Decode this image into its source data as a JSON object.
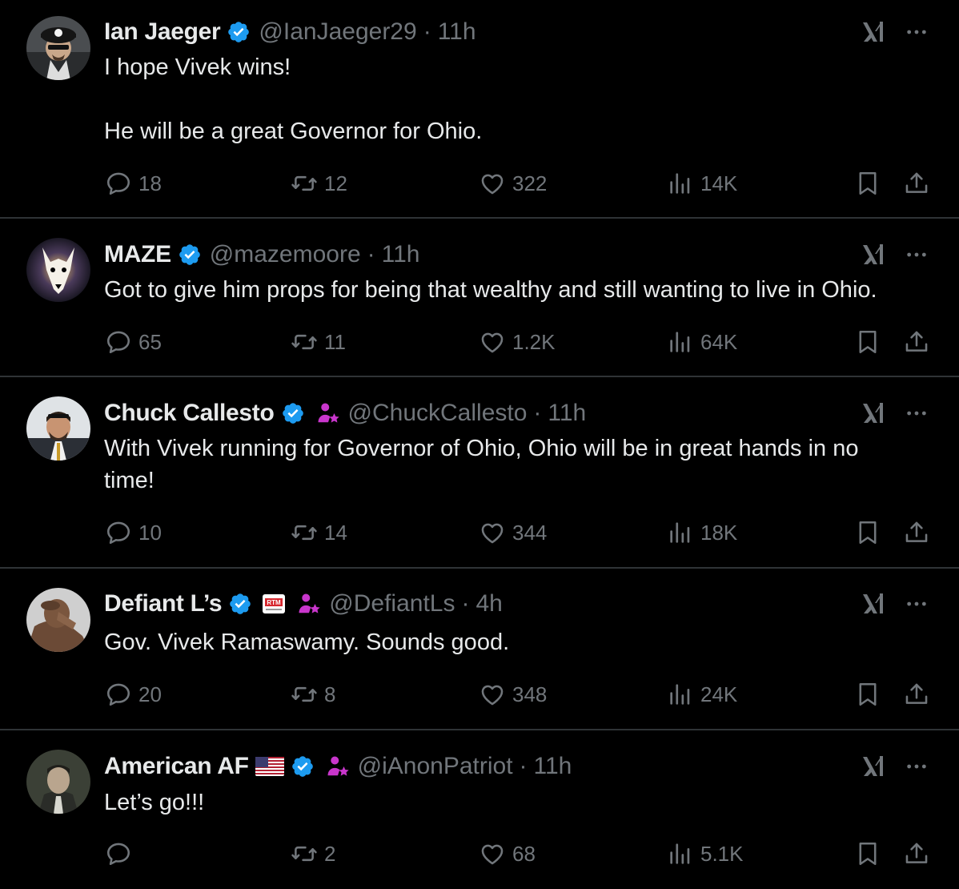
{
  "colors": {
    "background": "#000000",
    "text": "#e7e9ea",
    "muted": "#71767b",
    "verified": "#1d9bf0",
    "affiliate": "#c936cc",
    "divider": "#2f3336"
  },
  "tweets": [
    {
      "name": "Ian Jaeger",
      "handle": "@IanJaeger29",
      "separator": "·",
      "time": "11h",
      "text": "I hope Vivek wins!\n\nHe will be a great Governor for Ohio.",
      "replies": "18",
      "reposts": "12",
      "likes": "322",
      "views": "14K",
      "badges": [
        "verified-badge-icon"
      ]
    },
    {
      "name": "MAZE",
      "handle": "@mazemoore",
      "separator": "·",
      "time": "11h",
      "text": "Got to give him props for being that wealthy and still wanting to live in Ohio.",
      "replies": "65",
      "reposts": "11",
      "likes": "1.2K",
      "views": "64K",
      "badges": [
        "verified-badge-icon"
      ]
    },
    {
      "name": "Chuck Callesto",
      "handle": "@ChuckCallesto",
      "separator": "·",
      "time": "11h",
      "text": "With Vivek running for Governor of Ohio, Ohio will be in great hands in no time!",
      "replies": "10",
      "reposts": "14",
      "likes": "344",
      "views": "18K",
      "badges": [
        "verified-badge-icon",
        "affiliate-person-icon"
      ]
    },
    {
      "name": "Defiant L’s",
      "handle": "@DefiantLs",
      "separator": "·",
      "time": "4h",
      "text": "Gov. Vivek Ramaswamy. Sounds good.",
      "replies": "20",
      "reposts": "8",
      "likes": "348",
      "views": "24K",
      "badges": [
        "verified-badge-icon",
        "rtm-logo",
        "affiliate-person-icon"
      ],
      "rtm_label": "RTM"
    },
    {
      "name": "American AF",
      "handle": "@iAnonPatriot",
      "separator": "·",
      "time": "11h",
      "text": "Let’s go!!!",
      "replies": "",
      "reposts": "2",
      "likes": "68",
      "views": "5.1K",
      "badges": [
        "us-flag-icon",
        "verified-badge-icon",
        "affiliate-person-icon"
      ]
    }
  ],
  "icons": {
    "reply": "speech-bubble-icon",
    "repost": "repost-arrows-icon",
    "like": "heart-icon",
    "views": "bar-chart-icon",
    "bookmark": "bookmark-icon",
    "share": "share-upload-icon",
    "grok": "grok-icon",
    "more": "more-dots-icon"
  }
}
